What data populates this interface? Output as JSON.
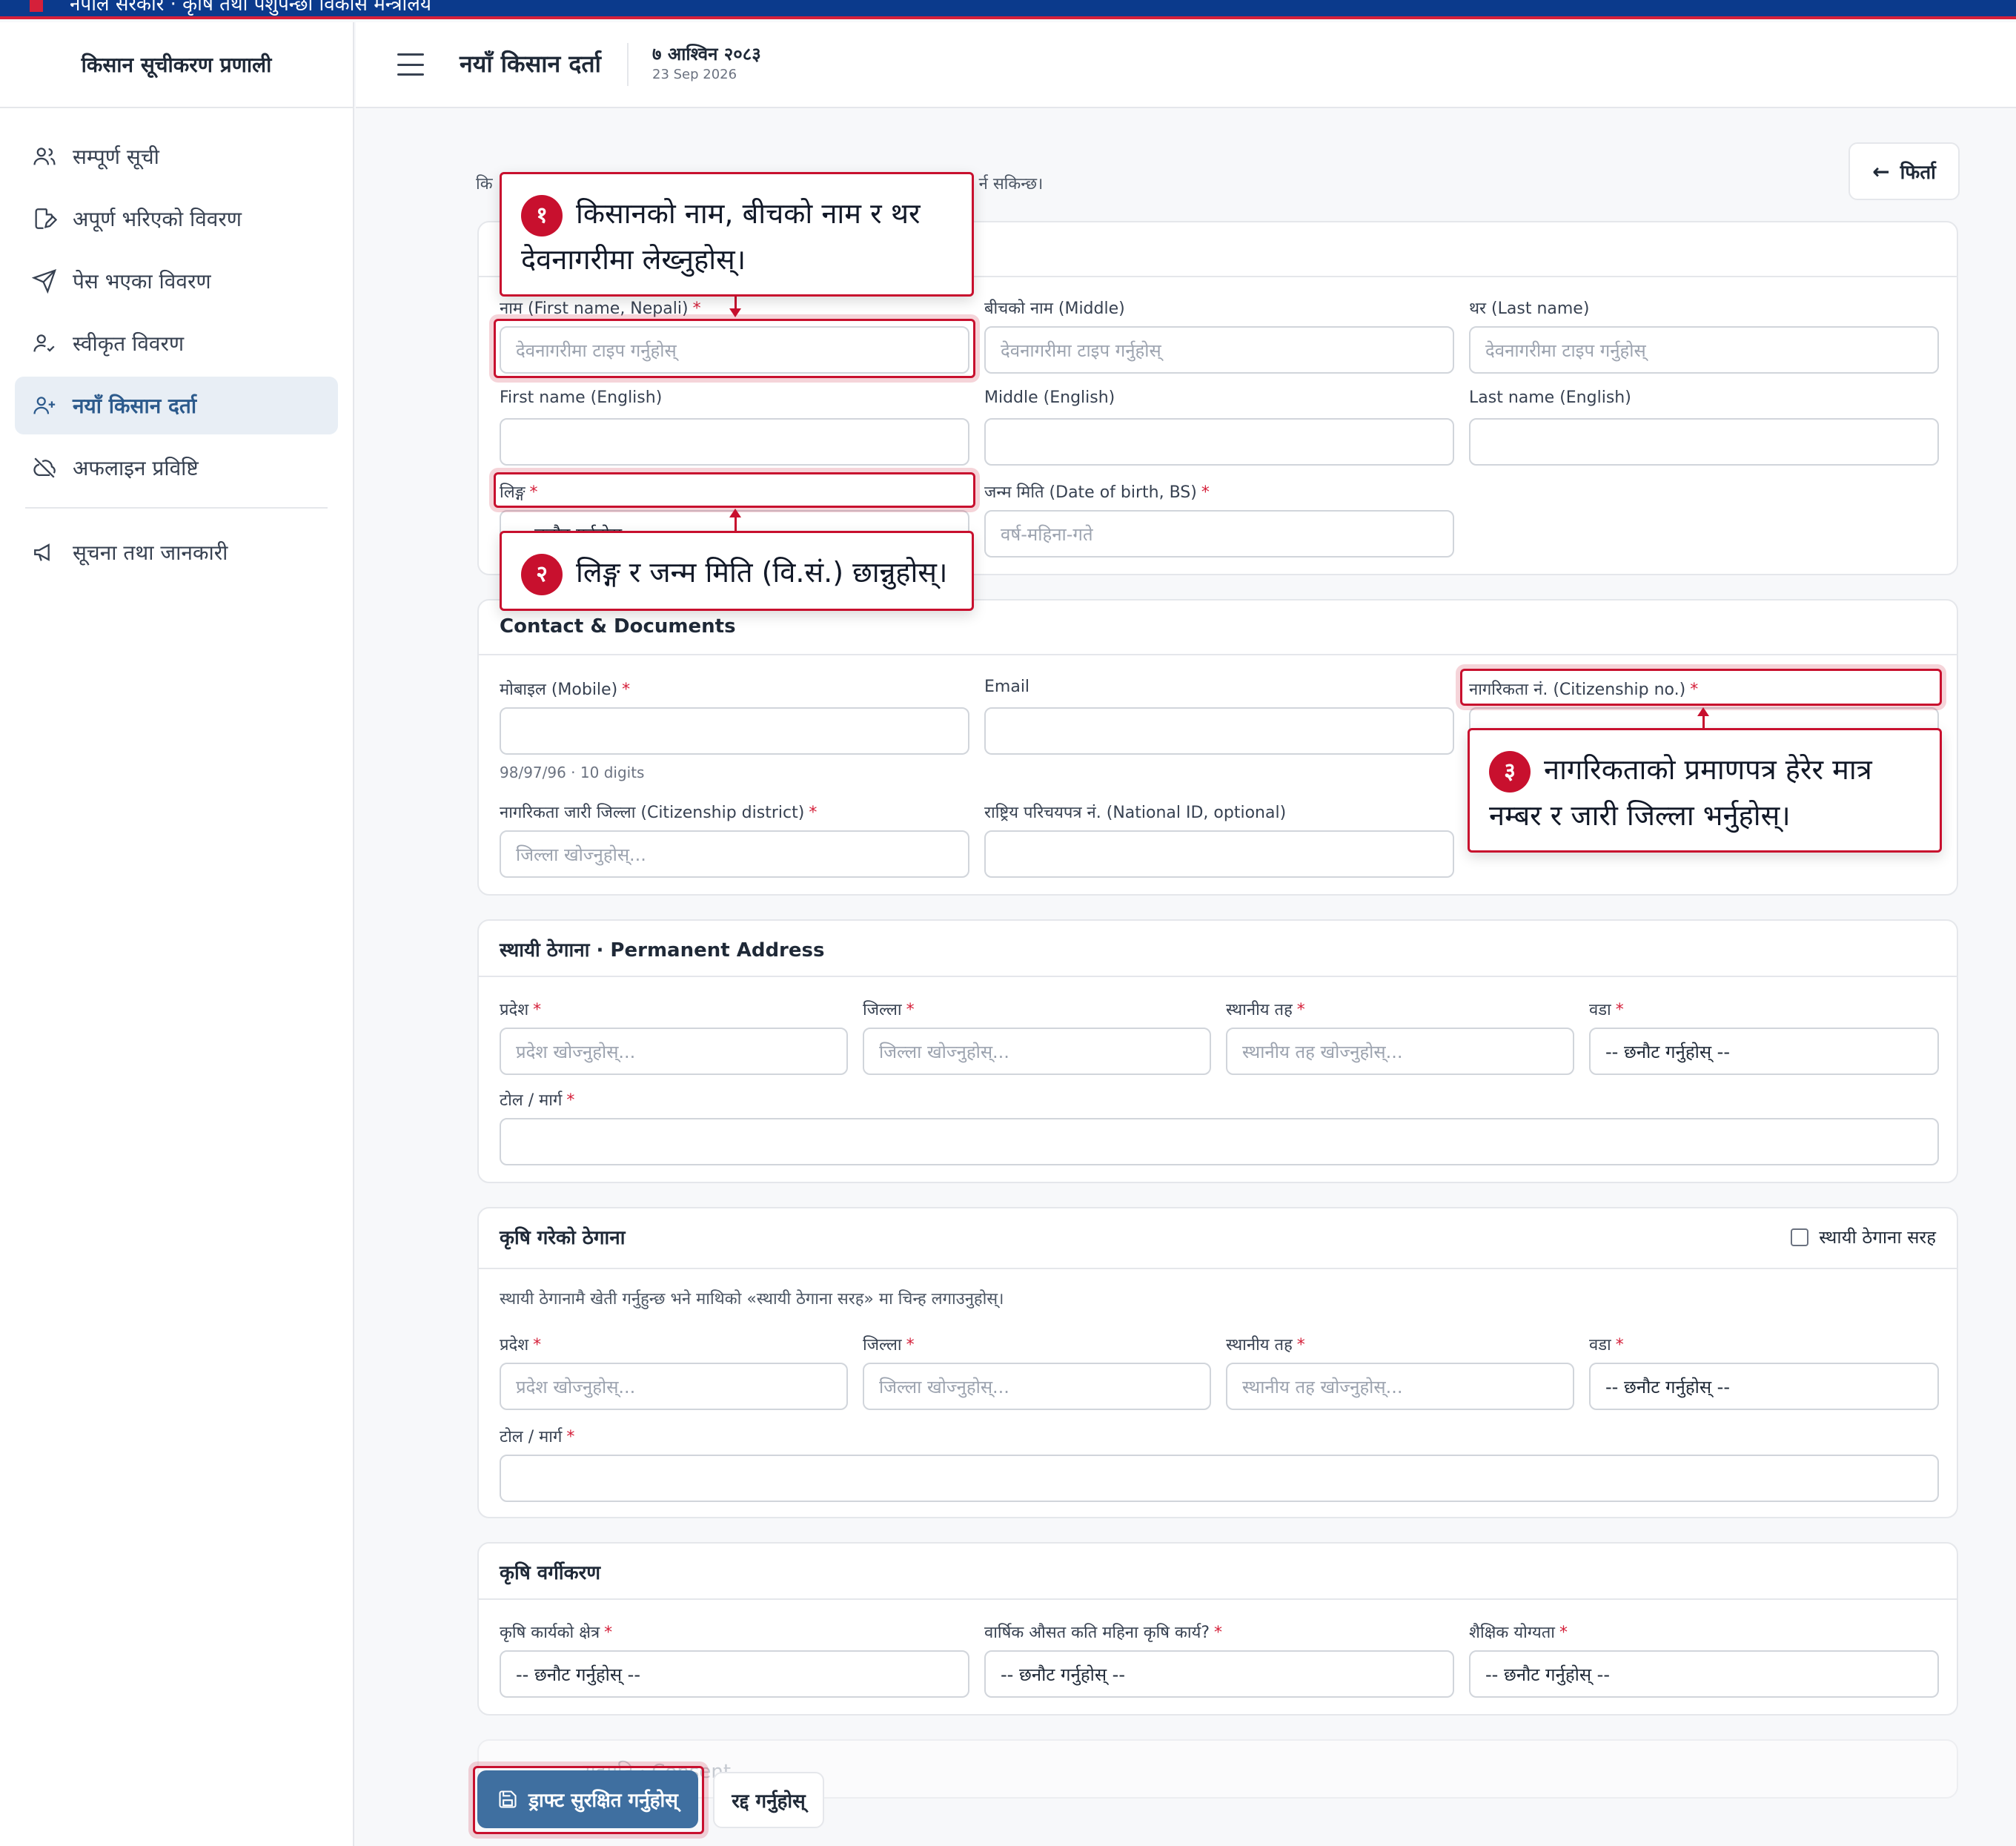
{
  "topbar": {
    "text": "नेपाल सरकार · कृषि तथा पशुपन्छी विकास मन्त्रालय"
  },
  "sidebar": {
    "brand": "किसान सूचीकरण प्रणाली",
    "items": [
      {
        "label": "सम्पूर्ण सूची",
        "icon": "users-icon"
      },
      {
        "label": "अपूर्ण भरिएको विवरण",
        "icon": "file-edit-icon"
      },
      {
        "label": "पेस भएका विवरण",
        "icon": "send-icon"
      },
      {
        "label": "स्वीकृत विवरण",
        "icon": "user-check-icon"
      },
      {
        "label": "नयाँ किसान दर्ता",
        "icon": "user-plus-icon",
        "active": true
      },
      {
        "label": "अफलाइन प्रविष्टि",
        "icon": "cloud-off-icon"
      }
    ],
    "secondary": [
      {
        "label": "सूचना तथा जानकारी",
        "icon": "megaphone-icon"
      }
    ]
  },
  "header": {
    "title": "नयाँ किसान दर्ता",
    "date_bs": "७ आश्विन २०८३",
    "date_ad": "23 Sep 2026"
  },
  "intro": {
    "start": "कि",
    "end": "र्न सकिन्छ।"
  },
  "back_label": "फिर्ता",
  "personal": {
    "first_np": {
      "label": "नाम (First name, Nepali)",
      "placeholder": "देवनागरीमा टाइप गर्नुहोस्"
    },
    "middle_np": {
      "label": "बीचको नाम (Middle)",
      "placeholder": "देवनागरीमा टाइप गर्नुहोस्"
    },
    "last_np": {
      "label": "थर (Last name)",
      "placeholder": "देवनागरीमा टाइप गर्नुहोस्"
    },
    "first_en": {
      "label": "First name (English)"
    },
    "middle_en": {
      "label": "Middle (English)"
    },
    "last_en": {
      "label": "Last name (English)"
    },
    "gender": {
      "label": "लिङ्ग",
      "value": "-- छनौट गर्नुहोस् --"
    },
    "dob": {
      "label": "जन्म मिति (Date of birth, BS)",
      "placeholder": "वर्ष-महिना-गते"
    }
  },
  "contact": {
    "heading": "Contact & Documents",
    "mobile": {
      "label": "मोबाइल (Mobile)",
      "hint": "98/97/96 · 10 digits"
    },
    "email": {
      "label": "Email"
    },
    "citizenship_no": {
      "label": "नागरिकता नं. (Citizenship no.)"
    },
    "citizenship_district": {
      "label": "नागरिकता जारी जिल्ला (Citizenship district)",
      "placeholder": "जिल्ला खोज्नुहोस्..."
    },
    "national_id": {
      "label": "राष्ट्रिय परिचयपत्र नं. (National ID, optional)"
    }
  },
  "permanent": {
    "heading": "स्थायी ठेगाना · Permanent Address",
    "province": {
      "label": "प्रदेश",
      "placeholder": "प्रदेश खोज्नुहोस्..."
    },
    "district": {
      "label": "जिल्ला",
      "placeholder": "जिल्ला खोज्नुहोस्..."
    },
    "local": {
      "label": "स्थानीय तह",
      "placeholder": "स्थानीय तह खोज्नुहोस्..."
    },
    "ward": {
      "label": "वडा",
      "value": "-- छनौट गर्नुहोस् --"
    },
    "tole": {
      "label": "टोल / मार्ग"
    }
  },
  "farm": {
    "heading": "कृषि गरेको ठेगाना",
    "same_label": "स्थायी ठेगाना सरह",
    "note": "स्थायी ठेगानामै खेती गर्नुहुन्छ भने माथिको «स्थायी ठेगाना सरह» मा चिन्ह लगाउनुहोस्।",
    "province": {
      "label": "प्रदेश",
      "placeholder": "प्रदेश खोज्नुहोस्..."
    },
    "district": {
      "label": "जिल्ला",
      "placeholder": "जिल्ला खोज्नुहोस्..."
    },
    "local": {
      "label": "स्थानीय तह",
      "placeholder": "स्थानीय तह खोज्नुहोस्..."
    },
    "ward": {
      "label": "वडा",
      "value": "-- छनौट गर्नुहोस् --"
    },
    "tole": {
      "label": "टोल / मार्ग"
    }
  },
  "classification": {
    "heading": "कृषि वर्गीकरण",
    "sector": {
      "label": "कृषि कार्यको क्षेत्र",
      "value": "-- छनौट गर्नुहोस् --"
    },
    "months": {
      "label": "वार्षिक औसत कति महिना कृषि कार्य?",
      "value": "-- छनौट गर्नुहोस् --"
    },
    "education": {
      "label": "शैक्षिक योग्यता",
      "value": "-- छनौट गर्नुहोस् --"
    }
  },
  "consent_text": "सहमति · Consent",
  "actions": {
    "save": "ड्राफ्ट सुरक्षित गर्नुहोस्",
    "cancel": "रद्द गर्नुहोस्"
  },
  "callouts": {
    "c1": {
      "num": "१",
      "text": "किसानको नाम, बीचको नाम र थर देवनागरीमा लेख्नुहोस्।"
    },
    "c2": {
      "num": "२",
      "text": "लिङ्ग र जन्म मिति (वि.सं.) छान्नुहोस्।"
    },
    "c3": {
      "num": "३",
      "text": "नागरिकताको प्रमाणपत्र हेरेर मात्र नम्बर र जारी जिल्ला भर्नुहोस्।"
    }
  },
  "colors": {
    "accent": "#3f6fa0",
    "highlight": "#c8102e",
    "nav_active_bg": "#e8eef5",
    "top_band": "#0b3a8c"
  }
}
